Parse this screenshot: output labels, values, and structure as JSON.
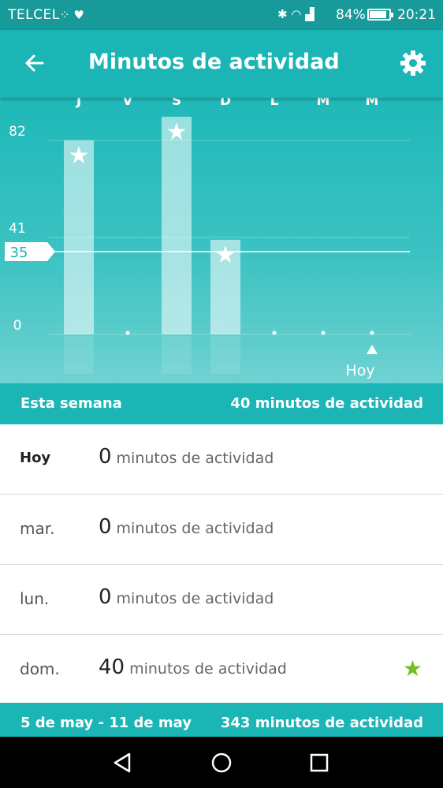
{
  "status_bar": {
    "carrier": "TELCEL",
    "battery": "84%",
    "time": "20:21"
  },
  "app_bar": {
    "title": "Minutos de actividad"
  },
  "chart_data": {
    "type": "bar",
    "categories": [
      "J",
      "V",
      "S",
      "D",
      "L",
      "M",
      "M"
    ],
    "values": [
      82,
      0,
      92,
      40,
      0,
      0,
      0
    ],
    "goal_reached": [
      true,
      false,
      true,
      true,
      false,
      false,
      false
    ],
    "y_ticks": [
      0,
      41,
      82
    ],
    "goal_line": 35,
    "ylim": [
      0,
      100
    ],
    "today_index": 6,
    "today_label": "Hoy",
    "colors": {
      "bar": "#ffffff",
      "goal_line": "#ffffff"
    }
  },
  "summary": {
    "label": "Esta semana",
    "total": "40 minutos de actividad"
  },
  "days": [
    {
      "day": "Hoy",
      "value": "0",
      "unit": "minutos de actividad",
      "star": false,
      "today": true
    },
    {
      "day": "mar.",
      "value": "0",
      "unit": "minutos de actividad",
      "star": false,
      "today": false
    },
    {
      "day": "lun.",
      "value": "0",
      "unit": "minutos de actividad",
      "star": false,
      "today": false
    },
    {
      "day": "dom.",
      "value": "40",
      "unit": "minutos de actividad",
      "star": true,
      "today": false
    }
  ],
  "previous_week": {
    "range": "5 de may - 11 de may",
    "total": "343 minutos de actividad"
  },
  "colors": {
    "accent": "#1cb5b5",
    "status_bar": "#199a9a",
    "star_green": "#76bd22"
  }
}
